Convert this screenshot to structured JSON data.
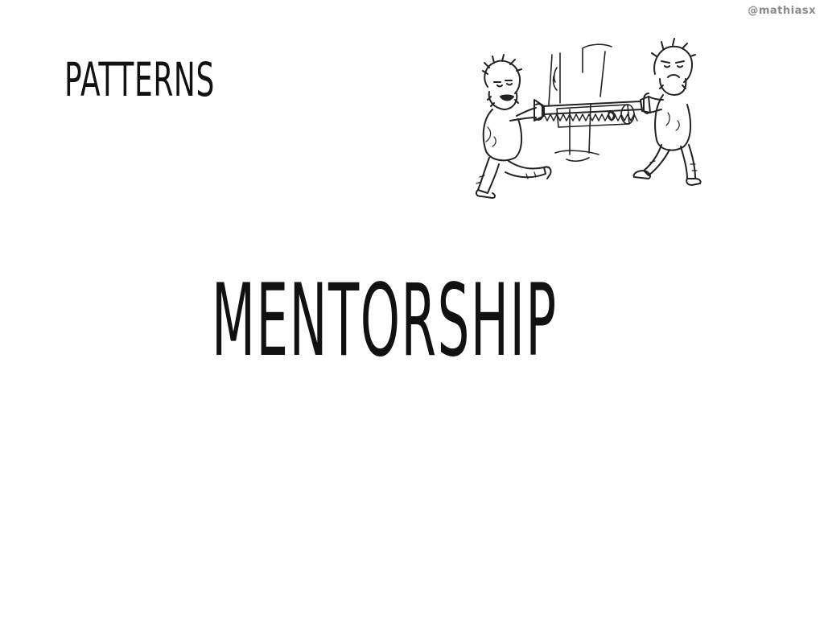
{
  "slide": {
    "handle": "@mathiasx",
    "section_title": "PATTERNS",
    "main_title": "MENTORSHIP",
    "illustration_icon": "two-cavemen-sawing-log-illustration",
    "colors": {
      "background": "#ffffff",
      "text": "#111111",
      "handle": "#8a8a8a"
    }
  }
}
